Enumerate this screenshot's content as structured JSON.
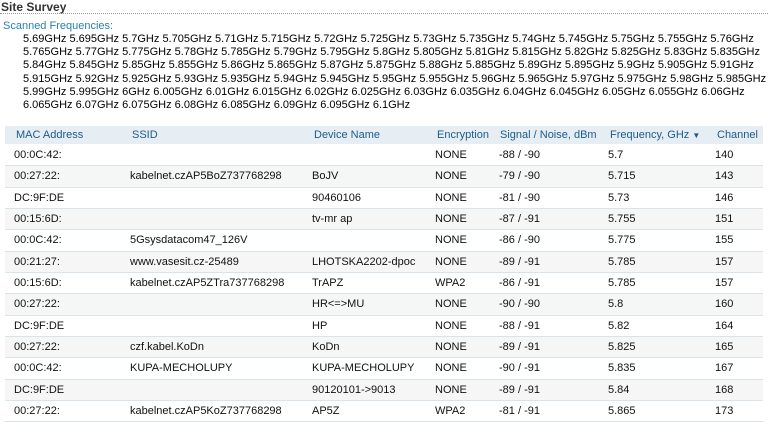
{
  "page": {
    "title": "Site Survey"
  },
  "scan": {
    "label": "Scanned Frequencies:",
    "frequencies": [
      "5.69GHz",
      "5.695GHz",
      "5.7GHz",
      "5.705GHz",
      "5.71GHz",
      "5.715GHz",
      "5.72GHz",
      "5.725GHz",
      "5.73GHz",
      "5.735GHz",
      "5.74GHz",
      "5.745GHz",
      "5.75GHz",
      "5.755GHz",
      "5.76GHz",
      "5.765GHz",
      "5.77GHz",
      "5.775GHz",
      "5.78GHz",
      "5.785GHz",
      "5.79GHz",
      "5.795GHz",
      "5.8GHz",
      "5.805GHz",
      "5.81GHz",
      "5.815GHz",
      "5.82GHz",
      "5.825GHz",
      "5.83GHz",
      "5.835GHz",
      "5.84GHz",
      "5.845GHz",
      "5.85GHz",
      "5.855GHz",
      "5.86GHz",
      "5.865GHz",
      "5.87GHz",
      "5.875GHz",
      "5.88GHz",
      "5.885GHz",
      "5.89GHz",
      "5.895GHz",
      "5.9GHz",
      "5.905GHz",
      "5.91GHz",
      "5.915GHz",
      "5.92GHz",
      "5.925GHz",
      "5.93GHz",
      "5.935GHz",
      "5.94GHz",
      "5.945GHz",
      "5.95GHz",
      "5.955GHz",
      "5.96GHz",
      "5.965GHz",
      "5.97GHz",
      "5.975GHz",
      "5.98GHz",
      "5.985GHz",
      "5.99GHz",
      "5.995GHz",
      "6GHz",
      "6.005GHz",
      "6.01GHz",
      "6.015GHz",
      "6.02GHz",
      "6.025GHz",
      "6.03GHz",
      "6.035GHz",
      "6.04GHz",
      "6.045GHz",
      "6.05GHz",
      "6.055GHz",
      "6.06GHz",
      "6.065GHz",
      "6.07GHz",
      "6.075GHz",
      "6.08GHz",
      "6.085GHz",
      "6.09GHz",
      "6.095GHz",
      "6.1GHz"
    ]
  },
  "table": {
    "headers": {
      "mac": "MAC Address",
      "ssid": "SSID",
      "device": "Device Name",
      "encryption": "Encryption",
      "signal": "Signal / Noise, dBm",
      "frequency": "Frequency, GHz",
      "channel": "Channel"
    },
    "sort_icon": "sort-descending-icon",
    "rows": [
      {
        "mac": "00:0C:42:",
        "ssid": "",
        "device": "",
        "encryption": "NONE",
        "signal": "-88 / -90",
        "frequency": "5.7",
        "channel": "140"
      },
      {
        "mac": "00:27:22:",
        "ssid": "kabelnet.czAP5BoZ737768298",
        "device": "BoJV",
        "encryption": "NONE",
        "signal": "-79 / -90",
        "frequency": "5.715",
        "channel": "143"
      },
      {
        "mac": "DC:9F:DE",
        "ssid": "",
        "device": "90460106",
        "encryption": "NONE",
        "signal": "-81 / -90",
        "frequency": "5.73",
        "channel": "146"
      },
      {
        "mac": "00:15:6D:",
        "ssid": "",
        "device": "tv-mr ap",
        "encryption": "NONE",
        "signal": "-87 / -91",
        "frequency": "5.755",
        "channel": "151"
      },
      {
        "mac": "00:0C:42:",
        "ssid": "5Gsysdatacom47_126V",
        "device": "",
        "encryption": "NONE",
        "signal": "-86 / -90",
        "frequency": "5.775",
        "channel": "155"
      },
      {
        "mac": "00:21:27:",
        "ssid": "www.vasesit.cz-25489",
        "device": "LHOTSKA2202-dpoc",
        "encryption": "NONE",
        "signal": "-89 / -91",
        "frequency": "5.785",
        "channel": "157"
      },
      {
        "mac": "00:15:6D:",
        "ssid": "kabelnet.czAP5ZTra737768298",
        "device": "TrAPZ",
        "encryption": "WPA2",
        "signal": "-86 / -91",
        "frequency": "5.785",
        "channel": "157"
      },
      {
        "mac": "00:27:22:",
        "ssid": "",
        "device": "HR<=>MU",
        "encryption": "NONE",
        "signal": "-90 / -90",
        "frequency": "5.8",
        "channel": "160"
      },
      {
        "mac": "DC:9F:DE",
        "ssid": "",
        "device": "HP",
        "encryption": "NONE",
        "signal": "-88 / -91",
        "frequency": "5.82",
        "channel": "164"
      },
      {
        "mac": "00:27:22:",
        "ssid": "czf.kabel.KoDn",
        "device": "KoDn",
        "encryption": "NONE",
        "signal": "-89 / -91",
        "frequency": "5.825",
        "channel": "165"
      },
      {
        "mac": "00:0C:42:",
        "ssid": "KUPA-MECHOLUPY",
        "device": "KUPA-MECHOLUPY",
        "encryption": "NONE",
        "signal": "-90 / -91",
        "frequency": "5.835",
        "channel": "167"
      },
      {
        "mac": "DC:9F:DE",
        "ssid": "",
        "device": "90120101->9013",
        "encryption": "NONE",
        "signal": "-89 / -91",
        "frequency": "5.84",
        "channel": "168"
      },
      {
        "mac": "00:27:22:",
        "ssid": "kabelnet.czAP5KoZ737768298",
        "device": "AP5Z",
        "encryption": "WPA2",
        "signal": "-81 / -91",
        "frequency": "5.865",
        "channel": "173"
      }
    ]
  }
}
